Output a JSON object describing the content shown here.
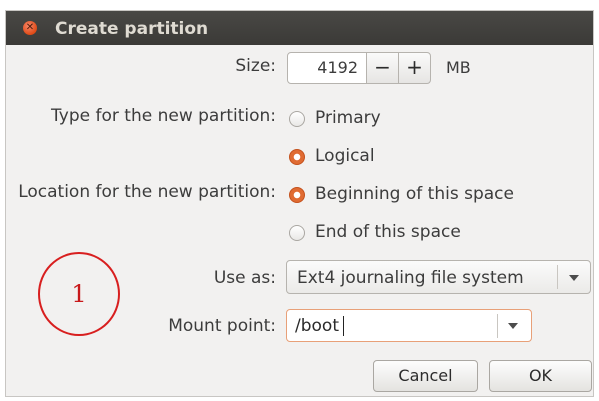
{
  "window": {
    "title": "Create partition",
    "close_symbol": "✕"
  },
  "size": {
    "label": "Size:",
    "value": "4192",
    "decrement": "−",
    "increment": "+",
    "unit": "MB"
  },
  "type": {
    "label": "Type for the new partition:",
    "options": [
      {
        "label": "Primary",
        "selected": false
      },
      {
        "label": "Logical",
        "selected": true
      }
    ]
  },
  "location": {
    "label": "Location for the new partition:",
    "options": [
      {
        "label": "Beginning of this space",
        "selected": true
      },
      {
        "label": "End of this space",
        "selected": false
      }
    ]
  },
  "use_as": {
    "label": "Use as:",
    "value": "Ext4 journaling file system"
  },
  "mount_point": {
    "label": "Mount point:",
    "value": "/boot"
  },
  "buttons": {
    "cancel": "Cancel",
    "ok": "OK"
  },
  "annotation": {
    "number": "1",
    "color": "#d81f1f"
  },
  "colors": {
    "accent": "#e06b32",
    "titlebar": "#3b3a37",
    "dialog_bg": "#f2f1f0"
  }
}
